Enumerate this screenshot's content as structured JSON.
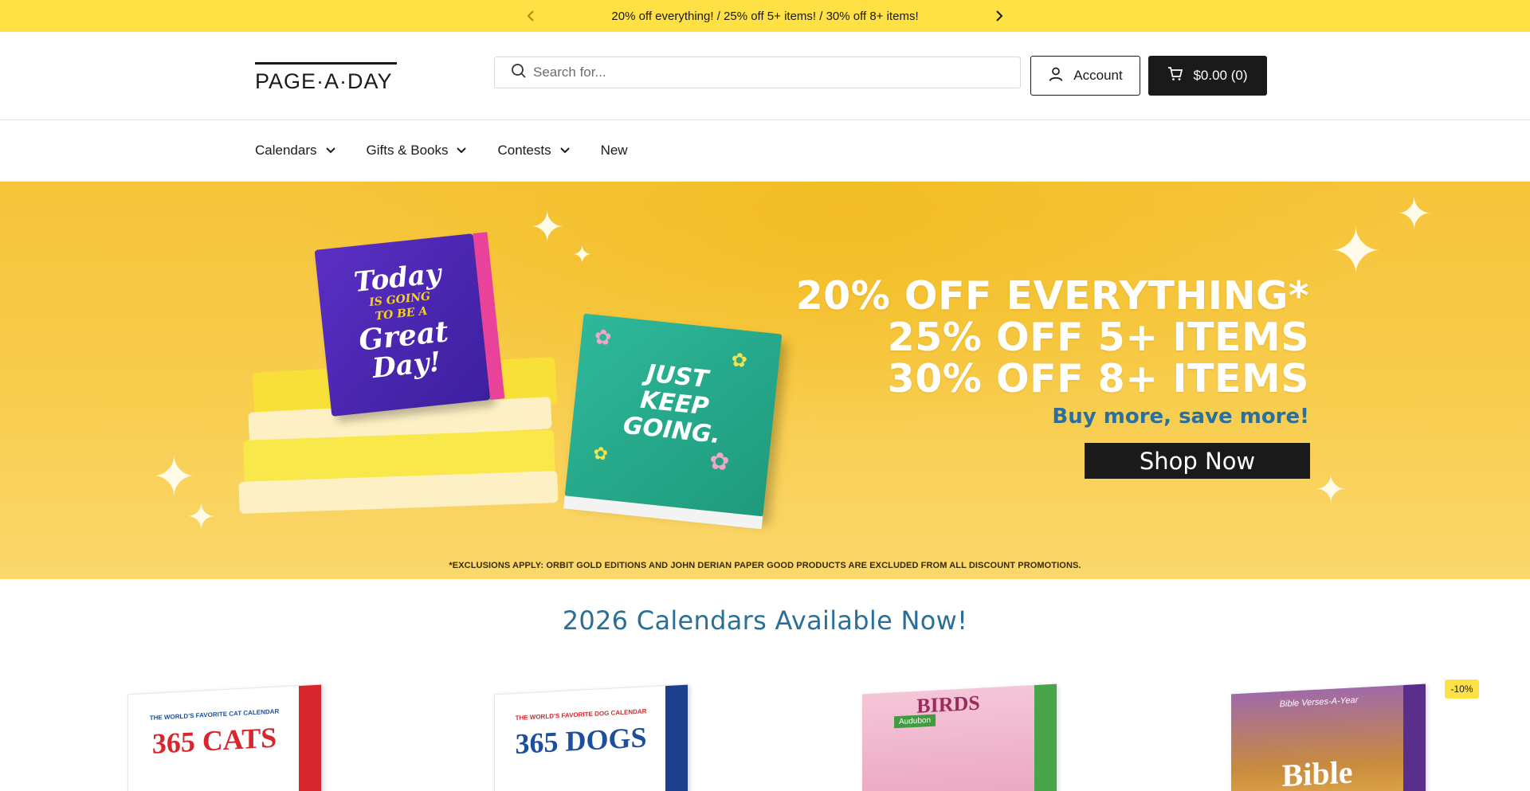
{
  "announcement": {
    "text": "20% off everything! / 25% off 5+ items! / 30% off 8+ items!",
    "prev_icon": "chevron-left-icon",
    "next_icon": "chevron-right-icon"
  },
  "header": {
    "logo_text": "PAGE·A·DAY",
    "search_placeholder": "Search for...",
    "account_label": "Account",
    "cart_label": "$0.00 (0)"
  },
  "nav": {
    "items": [
      {
        "label": "Calendars",
        "has_dropdown": true
      },
      {
        "label": "Gifts & Books",
        "has_dropdown": true
      },
      {
        "label": "Contests",
        "has_dropdown": true
      },
      {
        "label": "New",
        "has_dropdown": false
      }
    ]
  },
  "hero": {
    "line1": "20% OFF EVERYTHING*",
    "line2": "25% OFF 5+ ITEMS",
    "line3": "30% OFF 8+ ITEMS",
    "subline": "Buy more, save more!",
    "cta": "Shop Now",
    "disclaimer": "*EXCLUSIONS APPLY: ORBIT GOLD EDITIONS AND JOHN DERIAN PAPER GOOD PRODUCTS ARE EXCLUDED FROM ALL DISCOUNT PROMOTIONS.",
    "book1_lines": [
      "Today",
      "IS GOING",
      "TO BE A",
      "Great",
      "Day!"
    ],
    "book2_lines": [
      "JUST",
      "KEEP",
      "GOING."
    ]
  },
  "section": {
    "title": "2026 Calendars Available Now!"
  },
  "products": [
    {
      "label": "365 CATS",
      "tagline": "THE WORLD'S FAVORITE CAT CALENDAR",
      "color": "#d8262e",
      "side": "#d8262e"
    },
    {
      "label": "365 DOGS",
      "tagline": "THE WORLD'S FAVORITE DOG CALENDAR",
      "color": "#1d4f9c",
      "side": "#1d3f8c"
    },
    {
      "label": "BIRDS",
      "tagline": "Audubon",
      "color": "#9b2b5c",
      "side": "#4aa54a"
    },
    {
      "label": "Bible",
      "tagline": "Bible Verses-A-Year",
      "color": "#ffffff",
      "side": "#5a2f8c",
      "badge": "-10%"
    }
  ],
  "colors": {
    "announce_bg": "#ffe045",
    "hero_bg": "#f6c43a",
    "accent_blue": "#2b6f96",
    "dark": "#1a1a1a"
  }
}
